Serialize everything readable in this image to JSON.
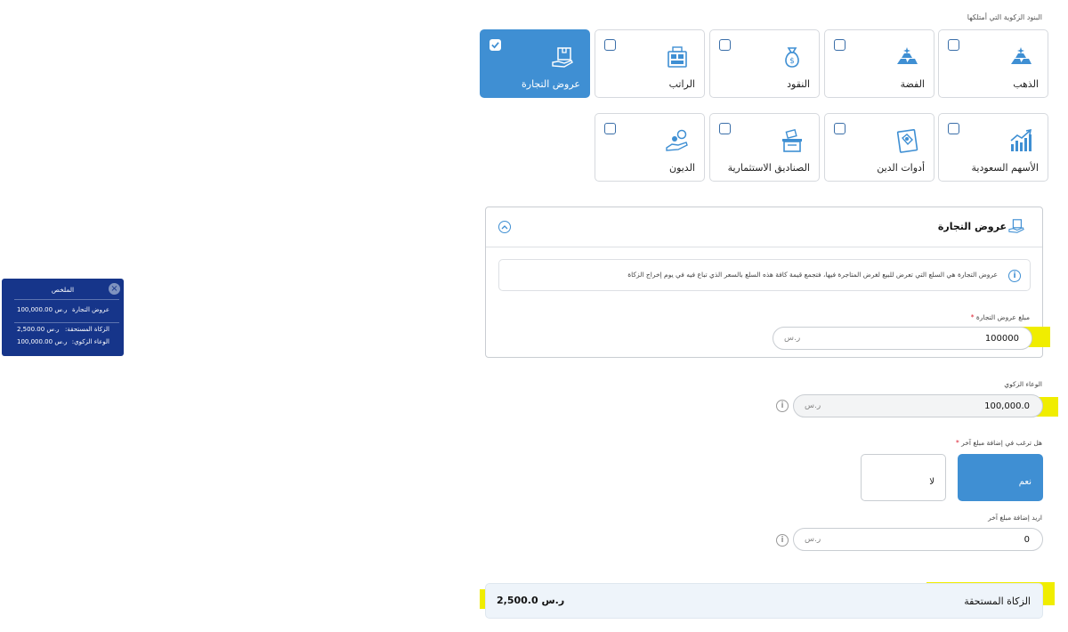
{
  "section_label": "البنود الزكوية التي أمتلكها",
  "assets_row1": [
    {
      "label": "الذهب",
      "icon": "gold-bars-icon",
      "checked": false
    },
    {
      "label": "الفضة",
      "icon": "silver-bars-icon",
      "checked": false
    },
    {
      "label": "النقود",
      "icon": "money-bag-icon",
      "checked": false
    },
    {
      "label": "الراتب",
      "icon": "salary-icon",
      "checked": false
    },
    {
      "label": "عروض التجارة",
      "icon": "trade-box-icon",
      "checked": true
    }
  ],
  "assets_row2": [
    {
      "label": "الأسهم السعودية",
      "icon": "stocks-chart-icon",
      "checked": false
    },
    {
      "label": "أدوات الدين",
      "icon": "debt-instruments-icon",
      "checked": false
    },
    {
      "label": "الصناديق الاستثمارية",
      "icon": "investment-funds-icon",
      "checked": false
    },
    {
      "label": "الديون",
      "icon": "debts-hand-icon",
      "checked": false
    }
  ],
  "trade_panel": {
    "title": "عروض التجارة",
    "info": "عروض التجارة هي السلع التي تعرض للبيع لغرض المتاجرة فيها، فتجمع قيمة كافة هذه السلع بالسعر الذي تباع فيه في يوم إخراج الزكاة",
    "amount_label": "مبلغ عروض التجارة",
    "amount_value": "100000",
    "currency": "ر.س"
  },
  "zakat_base": {
    "label": "الوعاء الزكوي",
    "value": "100,000.0",
    "currency": "ر.س"
  },
  "add_amount": {
    "question": "هل ترغب في إضافة مبلغ آخر",
    "yes_label": "نعم",
    "no_label": "لا",
    "selected": "yes",
    "extra_label": "اريد إضافة مبلغ آخر",
    "extra_value": "0",
    "currency": "ر.س"
  },
  "result": {
    "label": "الزكاة المستحقة",
    "value": "2,500.0 ر.س"
  },
  "summary": {
    "title": "الملخص",
    "rows": [
      {
        "key": "عروض التجارة",
        "value": "100,000.00 ر.س"
      },
      {
        "key": "الزكاة المستحقة:",
        "value": "2,500.00 ر.س"
      },
      {
        "key": "الوعاء الزكوي:",
        "value": "100,000.00 ر.س"
      }
    ]
  },
  "colors": {
    "accent": "#3f8fd3",
    "summary_bg": "#16358a",
    "highlight": "#f0ed00"
  }
}
